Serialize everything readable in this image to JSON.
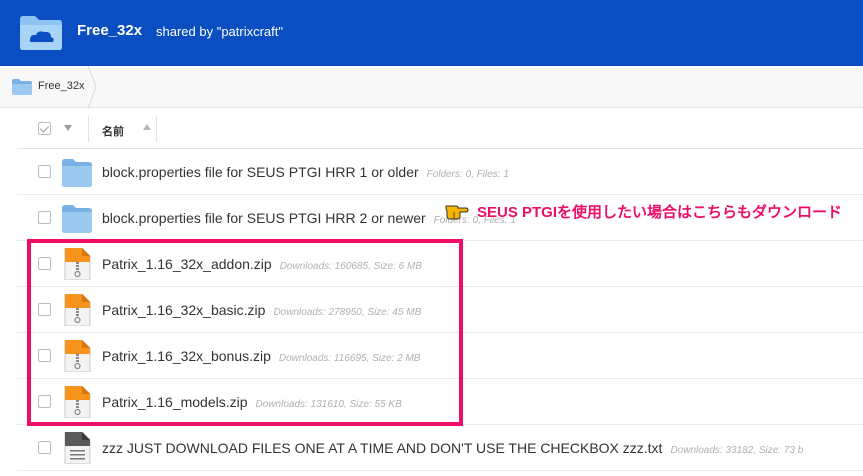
{
  "header": {
    "title": "Free_32x",
    "subtitle": "shared by \"patrixcraft\"",
    "icon": "cloud-folder-icon",
    "bg_color": "#0b4ec2"
  },
  "breadcrumb": {
    "label": "Free_32x",
    "icon": "folder-icon"
  },
  "columns": {
    "name": "名前"
  },
  "rows": [
    {
      "name": "block.properties file for SEUS PTGI HRR 1 or older",
      "meta": "Folders: 0, Files: 1",
      "type": "folder"
    },
    {
      "name": "block.properties file for SEUS PTGI HRR 2 or newer",
      "meta": "Folders: 0, Files: 1",
      "type": "folder"
    },
    {
      "name": "Patrix_1.16_32x_addon.zip",
      "meta": "Downloads: 160685, Size: 6 MB",
      "type": "zip"
    },
    {
      "name": "Patrix_1.16_32x_basic.zip",
      "meta": "Downloads: 278950, Size: 45 MB",
      "type": "zip"
    },
    {
      "name": "Patrix_1.16_32x_bonus.zip",
      "meta": "Downloads: 116695, Size: 2 MB",
      "type": "zip"
    },
    {
      "name": "Patrix_1.16_models.zip",
      "meta": "Downloads: 131610, Size: 55 KB",
      "type": "zip"
    },
    {
      "name": "zzz JUST DOWNLOAD FILES ONE AT A TIME AND DON'T USE THE CHECKBOX zzz.txt",
      "meta": "Downloads: 33182, Size: 73 b",
      "type": "txt"
    }
  ],
  "annotation": {
    "text": "SEUS PTGIを使用したい場合はこちらもダウンロード",
    "icon": "pointing-hand-icon",
    "color": "#ee0e67"
  }
}
